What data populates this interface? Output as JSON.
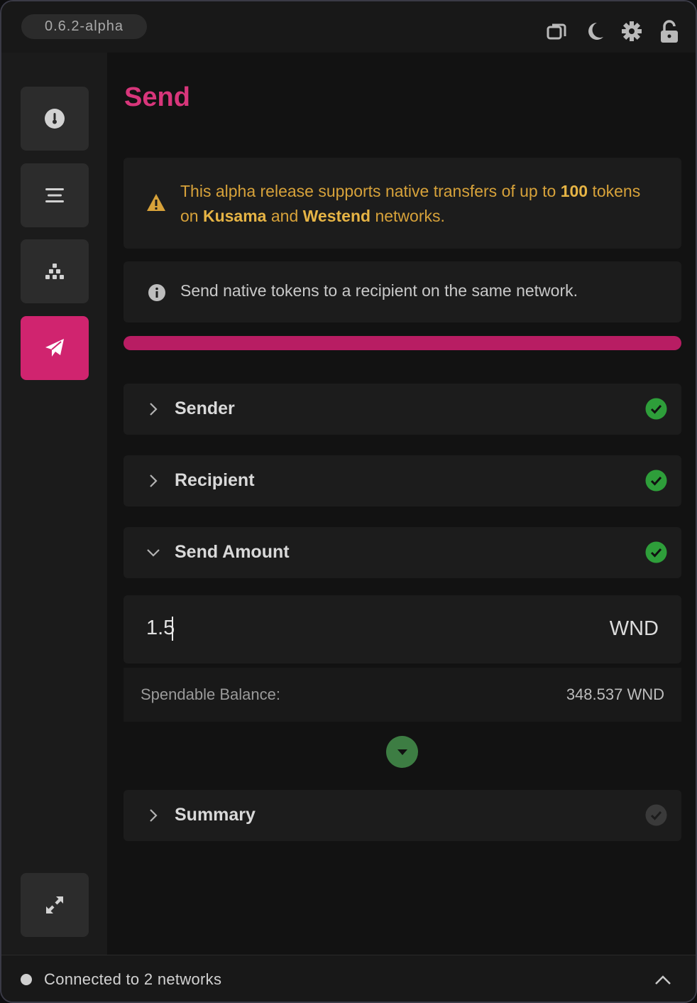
{
  "header": {
    "version": "0.6.2-alpha",
    "icons": [
      "windows-icon",
      "moon-icon",
      "gear-icon",
      "unlock-icon"
    ]
  },
  "sidebar": {
    "items": [
      {
        "name": "overview",
        "icon": "thermometer-icon",
        "active": false
      },
      {
        "name": "menu",
        "icon": "lines-icon",
        "active": false
      },
      {
        "name": "nominate",
        "icon": "stack-icon",
        "active": false
      },
      {
        "name": "send",
        "icon": "paper-plane-icon",
        "active": true
      }
    ],
    "bottom_icon": "expand-icon"
  },
  "main": {
    "title": "Send",
    "warning": {
      "pre": "This alpha release supports native transfers of up to ",
      "limit": "100",
      "mid1": " tokens on ",
      "net1": "Kusama",
      "mid2": " and ",
      "net2": "Westend",
      "post": " networks."
    },
    "info": "Send native tokens to a recipient on the same network.",
    "progress_fraction": 1.0,
    "sections": [
      {
        "label": "Sender",
        "expanded": false,
        "complete": true
      },
      {
        "label": "Recipient",
        "expanded": false,
        "complete": true
      },
      {
        "label": "Send Amount",
        "expanded": true,
        "complete": true
      },
      {
        "label": "Summary",
        "expanded": false,
        "complete": false
      }
    ],
    "amount": {
      "value": "1.5",
      "unit": "WND"
    },
    "balance": {
      "label": "Spendable Balance:",
      "value": "348.537 WND"
    }
  },
  "footer": {
    "status": "Connected to 2 networks"
  },
  "colors": {
    "accent": "#d0246f",
    "success": "#2e9e3a",
    "warning": "#d7a23a"
  }
}
